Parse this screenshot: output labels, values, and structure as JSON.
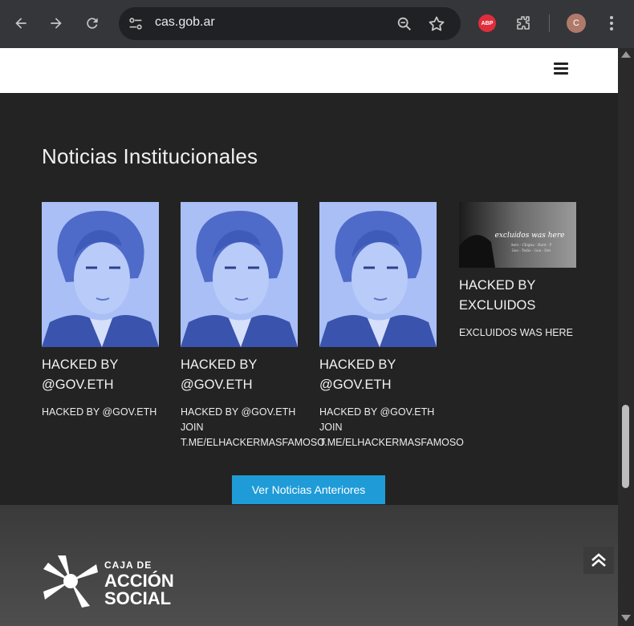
{
  "browser": {
    "url": "cas.gob.ar",
    "abp_label": "ABP",
    "avatar_letter": "C"
  },
  "page": {
    "section_title": "Noticias Institucionales",
    "cards": [
      {
        "title_line1": "HACKED BY",
        "title_line2": "@GOV.ETH",
        "text": "HACKED BY @GOV.ETH"
      },
      {
        "title_line1": "HACKED BY",
        "title_line2": "@GOV.ETH",
        "text": "HACKED BY @GOV.ETH\nJOIN\nT.ME/ELHACKERMASFAMOSO"
      },
      {
        "title_line1": "HACKED BY",
        "title_line2": "@GOV.ETH",
        "text": "HACKED BY @GOV.ETH\nJOIN\nT.ME/ELHACKERMASFAMOSO"
      },
      {
        "title_line1": "HACKED BY",
        "title_line2": "EXCLUIDOS",
        "text": "EXCLUIDOS WAS HERE",
        "image_caption": "excluidos was here",
        "image_subcaption": "Aero - Chigna - Hard - P\nGoo - Tedio - Gon - Dev"
      }
    ],
    "more_button": "Ver Noticias Anteriores"
  },
  "footer": {
    "logo_line1": "CAJA DE",
    "logo_line2": "ACCIÓN",
    "logo_line3": "SOCIAL"
  },
  "colors": {
    "accent": "#1f9bd7",
    "dark_bg": "#232323"
  }
}
